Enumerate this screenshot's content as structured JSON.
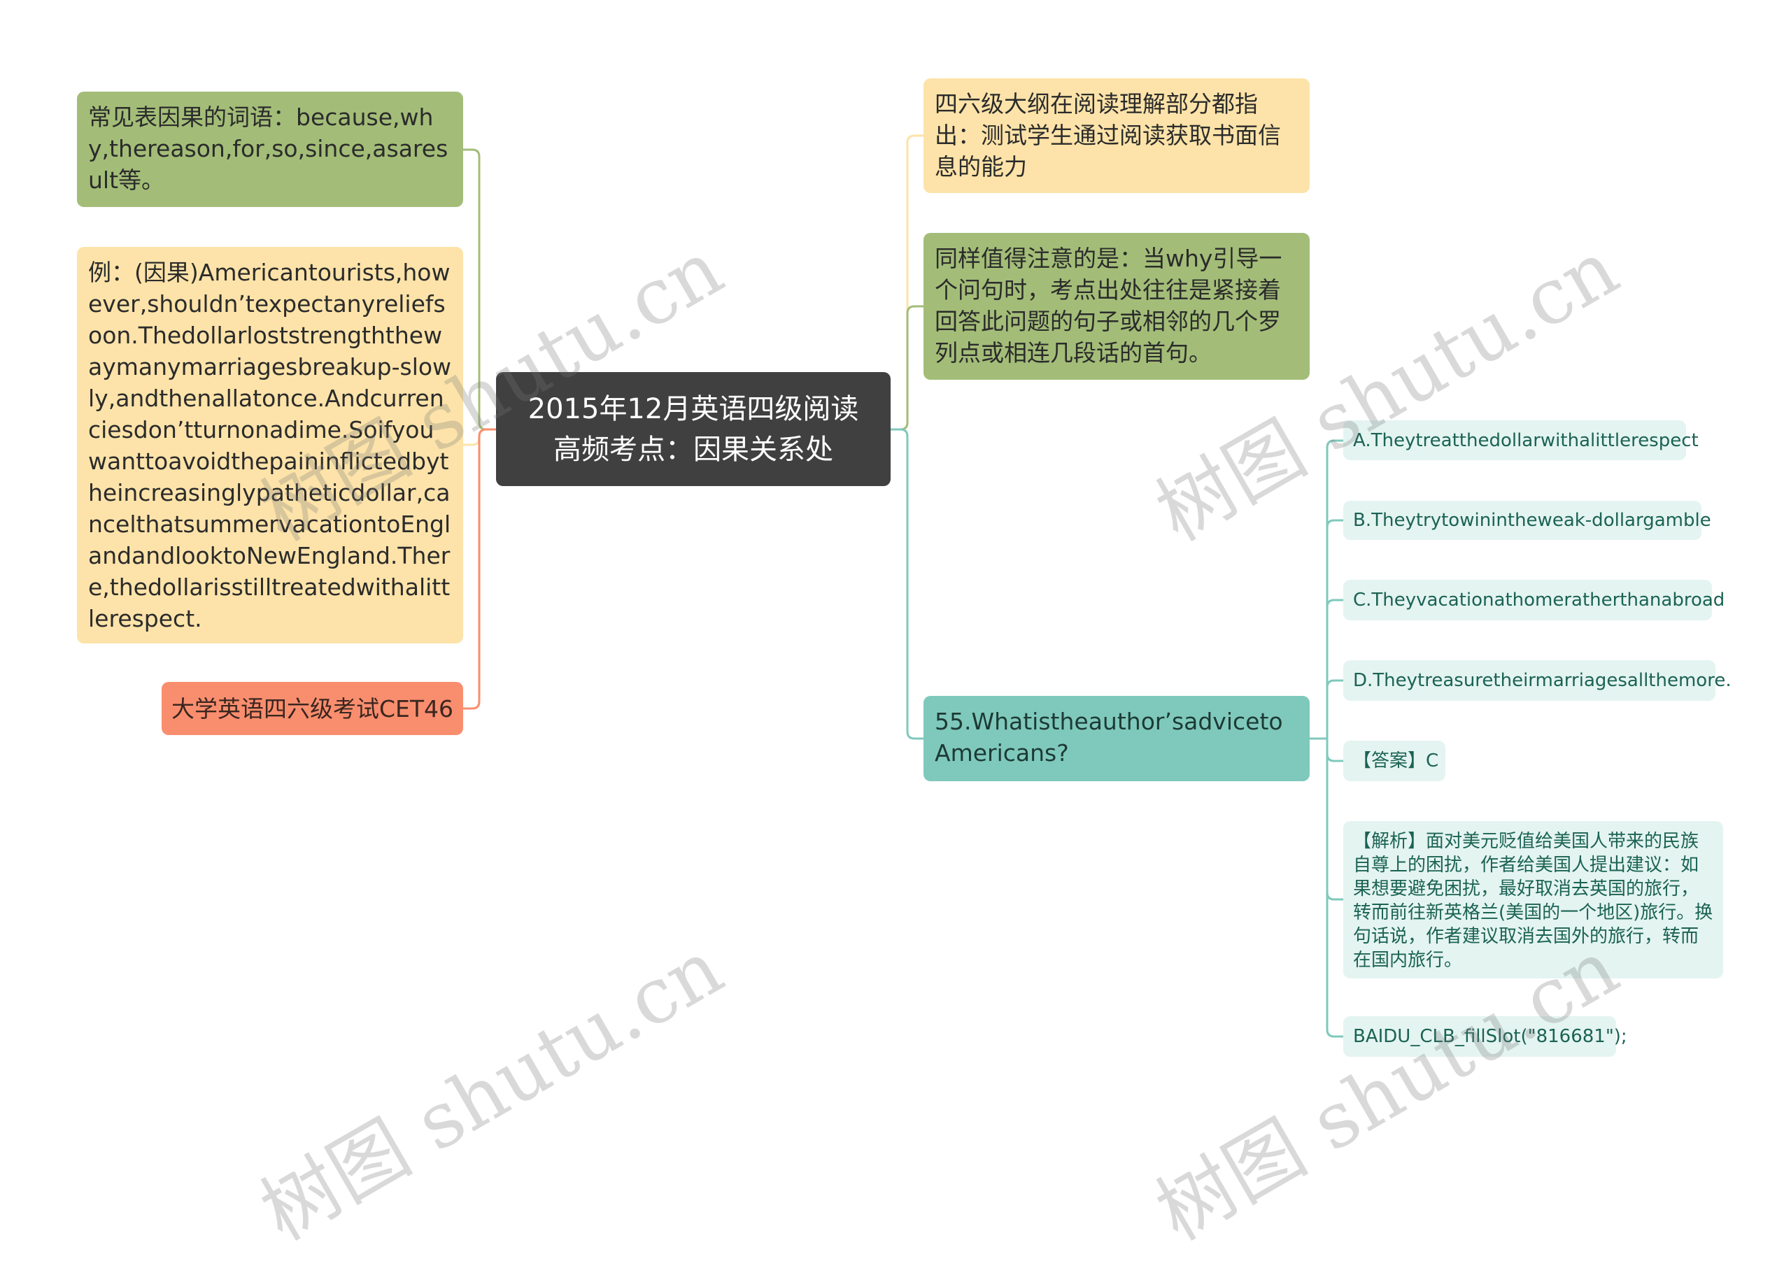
{
  "center": {
    "line1": "2015年12月英语四级阅读",
    "line2": "高频考点：因果关系处"
  },
  "left_nodes": [
    {
      "text": "常见表因果的词语：because,why,thereason,for,so,since,asaresult等。",
      "color": "#a3bd78"
    },
    {
      "text": "例：(因果)Americantourists,however,shouldn’texpectanyreliefsoon.Thedollarloststrengththewaymanymarriagesbreakup-slowly,andthenallatonce.Andcurrenciesdon’tturnonadime.Soifyouwanttoavoidthepaininflictedbytheincreasinglypatheticdollar,cancelthatsummervacationtoEnglandandlooktoNewEngland.There,thedollarisstilltreatedwithalittlerespect.",
      "color": "#fde3a9"
    },
    {
      "text": "大学英语四六级考试CET46",
      "color": "#f98e6e"
    }
  ],
  "right_nodes": [
    {
      "text": "四六级大纲在阅读理解部分都指出：测试学生通过阅读获取书面信息的能力",
      "color": "#fde3a9"
    },
    {
      "text": "同样值得注意的是：当why引导一个问句时，考点出处往往是紧接着回答此问题的句子或相邻的几个罗列点或相连几段话的首句。",
      "color": "#a3bd78"
    },
    {
      "text": "55.Whatistheauthor’sadvicetoAmericans?",
      "color": "#7fc9bc"
    }
  ],
  "question_children": [
    {
      "text": "A.Theytreatthedollarwithalittlerespect"
    },
    {
      "text": "B.Theytrytowinintheweak-dollargamble"
    },
    {
      "text": "C.Theyvacationathomeratherthanabroad"
    },
    {
      "text": "D.Theytreasuretheirmarriagesallthemore."
    },
    {
      "text": "【答案】C"
    },
    {
      "text": "【解析】面对美元贬值给美国人带来的民族自尊上的困扰，作者给美国人提出建议：如果想要避免困扰，最好取消去英国的旅行，转而前往新英格兰(美国的一个地区)旅行。换句话说，作者建议取消去国外的旅行，转而在国内旅行。"
    },
    {
      "text": "BAIDU_CLB_fillSlot(\"816681\");"
    }
  ],
  "watermark": "树图 shutu.cn",
  "colors": {
    "green": "#a3bd78",
    "yellow": "#fde3a9",
    "salmon": "#f98e6e",
    "teal": "#7fc9bc",
    "leaf": "#e4f4f1",
    "center": "#404040"
  }
}
